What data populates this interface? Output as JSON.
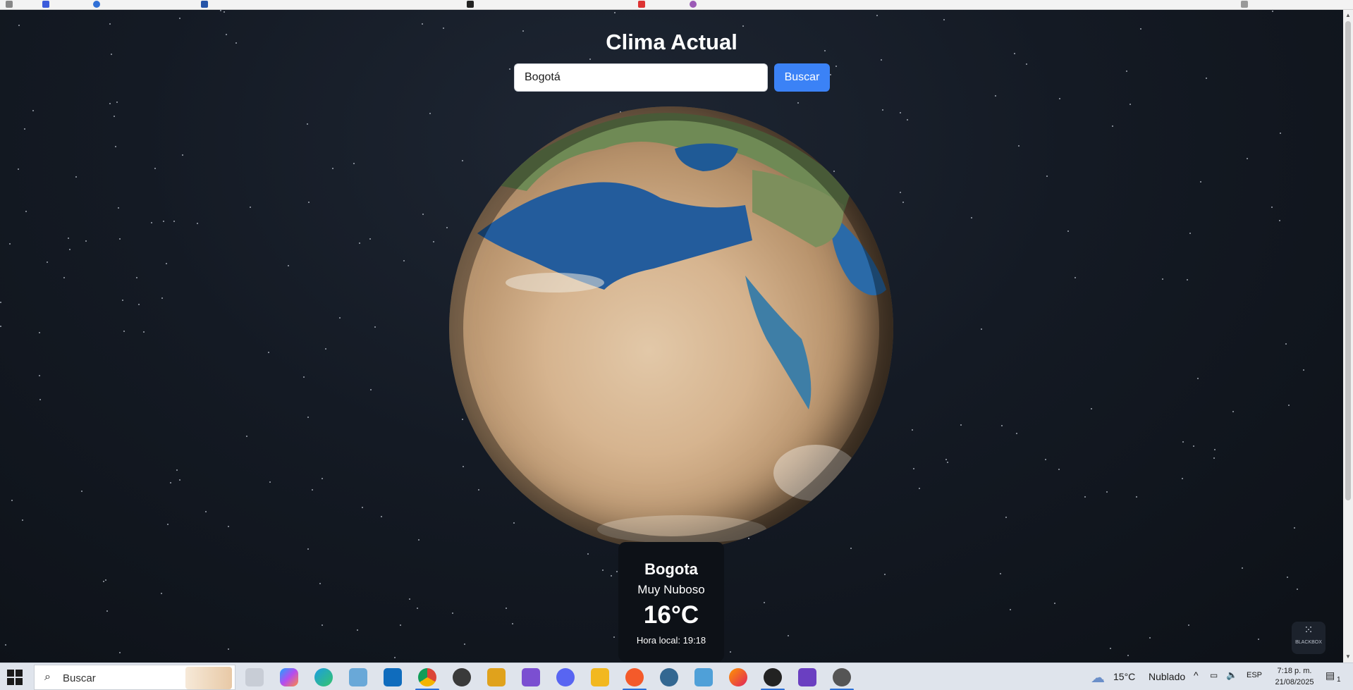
{
  "page": {
    "title": "Clima Actual",
    "search": {
      "value": "Bogotá",
      "button": "Buscar"
    }
  },
  "weather": {
    "city": "Bogota",
    "description": "Muy Nuboso",
    "temperature": "16°C",
    "local_time": "Hora local: 19:18"
  },
  "badge": {
    "label": "BLACKBOX"
  },
  "taskbar": {
    "search_placeholder": "Buscar",
    "weather": {
      "temp": "15°C",
      "condition": "Nublado"
    },
    "language": "ESP",
    "time": "7:18 p. m.",
    "date": "21/08/2025",
    "notification_count": "1",
    "apps": [
      "task-view",
      "copilot",
      "edge",
      "notepad",
      "outlook",
      "chrome",
      "obs",
      "file-tool",
      "visual-studio",
      "discord",
      "file-explorer",
      "brave",
      "postgres",
      "maps",
      "firefox",
      "unknown-app",
      "visual-studio-2",
      "settings"
    ]
  }
}
